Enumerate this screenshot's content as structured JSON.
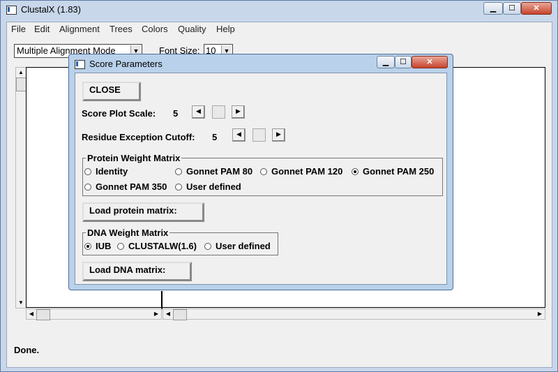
{
  "window": {
    "title": "ClustalX (1.83)"
  },
  "menubar": {
    "items": [
      "File",
      "Edit",
      "Alignment",
      "Trees",
      "Colors",
      "Quality",
      "Help"
    ]
  },
  "toolbar": {
    "mode": "Multiple Alignment Mode",
    "font_label": "Font Size:",
    "font_size": "10"
  },
  "status": "Done.",
  "dialog": {
    "title": "Score Parameters",
    "close_label": "CLOSE",
    "score_plot_scale": {
      "label": "Score Plot Scale:",
      "value": "5"
    },
    "residue_cutoff": {
      "label": "Residue Exception Cutoff:",
      "value": "5"
    },
    "protein_matrix": {
      "title": "Protein Weight Matrix",
      "options": [
        "Identity",
        "Gonnet PAM 80",
        "Gonnet PAM 120",
        "Gonnet PAM 250",
        "Gonnet PAM 350",
        "User defined"
      ],
      "selected": "Gonnet PAM 250"
    },
    "load_protein_label": "Load protein matrix:",
    "dna_matrix": {
      "title": "DNA Weight Matrix",
      "options": [
        "IUB",
        "CLUSTALW(1.6)",
        "User defined"
      ],
      "selected": "IUB"
    },
    "load_dna_label": "Load DNA matrix:"
  }
}
